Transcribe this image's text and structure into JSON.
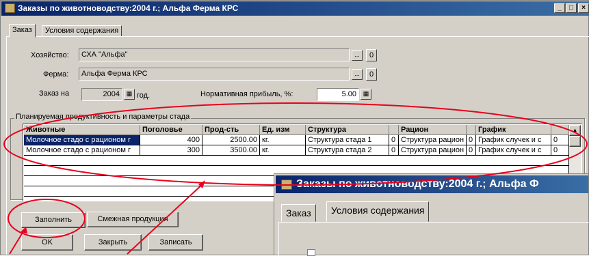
{
  "window": {
    "title": "Заказы по животноводству:2004 г.; Альфа Ферма КРС",
    "minimize": "_",
    "restore": "□",
    "close": "×"
  },
  "tabs": [
    {
      "label": "Заказ",
      "active": true
    },
    {
      "label": "Условия содержания",
      "active": false
    }
  ],
  "form": {
    "farm_owner_label": "Хозяйство:",
    "farm_owner_value": "СХА \"Альфа\"",
    "farm_owner_count": "0",
    "farm_label": "Ферма:",
    "farm_value": "Альфа Ферма КРС",
    "farm_count": "0",
    "order_label": "Заказ на",
    "year_value": "2004",
    "year_unit": "год.",
    "profit_label": "Нормативная прибыль, %:",
    "profit_value": "5.00",
    "browse_glyph": "..."
  },
  "group": {
    "label": "Планируемая продуктивность и параметры стада"
  },
  "grid": {
    "columns": [
      "Животные",
      "Поголовье",
      "Прод-сть",
      "Ед. изм",
      "Структура",
      "",
      "Рацион",
      "",
      "График",
      ""
    ],
    "rows": [
      [
        "Молочное стадо с рационом г",
        "400",
        "2500.00",
        "кг.",
        "Структура стада 1",
        "0",
        "Структура рацион",
        "0",
        "График случек и с",
        "0"
      ],
      [
        "Молочное стадо с рационом г",
        "300",
        "3500.00",
        "кг.",
        "Структура стада 2",
        "0",
        "Структура рацион",
        "0",
        "График случек и с",
        "0"
      ]
    ]
  },
  "buttons": {
    "fill": "Заполнить",
    "related": "Смежная продукция",
    "ok": "OK",
    "close": "Закрыть",
    "save": "Записать"
  },
  "zoom_popup": {
    "title": "Заказы по животноводству:2004 г.; Альфа Ф",
    "tab_order": "Заказ",
    "tab_conditions": "Условия содержания"
  },
  "annotation_colors": {
    "highlight": "#e8001c"
  }
}
